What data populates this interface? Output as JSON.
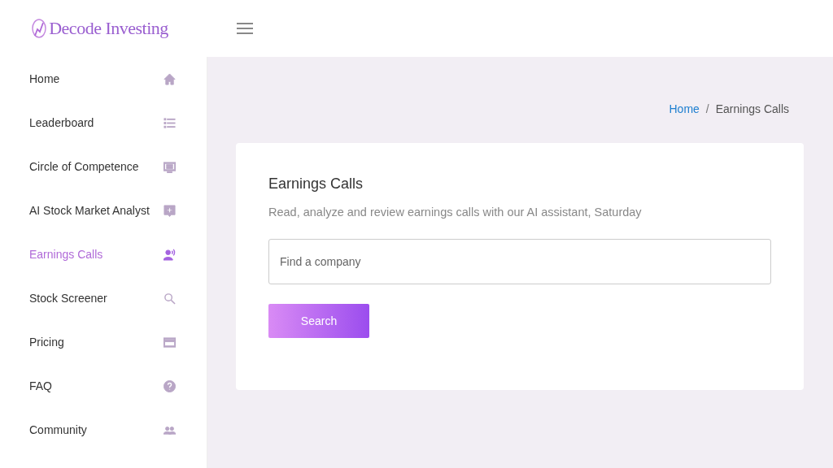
{
  "logo": {
    "text": "Decode Investing"
  },
  "sidebar": {
    "items": [
      {
        "label": "Home",
        "kind": "home",
        "selected": false
      },
      {
        "label": "Leaderboard",
        "kind": "list",
        "selected": false
      },
      {
        "label": "Circle of Competence",
        "kind": "screen",
        "selected": false
      },
      {
        "label": "AI Stock Market Analyst",
        "kind": "chat",
        "selected": false
      },
      {
        "label": "Earnings Calls",
        "kind": "speaker",
        "selected": true
      },
      {
        "label": "Stock Screener",
        "kind": "search",
        "selected": false
      },
      {
        "label": "Pricing",
        "kind": "card",
        "selected": false
      },
      {
        "label": "FAQ",
        "kind": "help",
        "selected": false
      },
      {
        "label": "Community",
        "kind": "people",
        "selected": false
      }
    ]
  },
  "breadcrumb": {
    "separator": "/",
    "items": [
      {
        "label": "Home",
        "link": true
      },
      {
        "label": "Earnings Calls",
        "link": false
      }
    ]
  },
  "card": {
    "title": "Earnings Calls",
    "subtitle": "Read, analyze and review earnings calls with our AI assistant, Saturday",
    "search": {
      "placeholder": "Find a company"
    },
    "button": "Search"
  }
}
